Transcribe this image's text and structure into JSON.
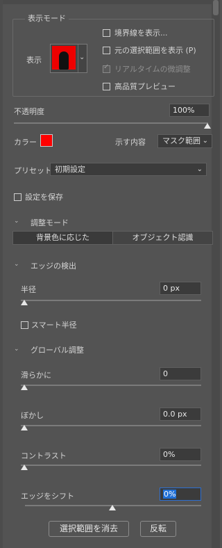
{
  "display_mode": {
    "title": "表示モード",
    "view_label": "表示",
    "options": [
      {
        "label": "境界線を表示...",
        "checked": false,
        "disabled": false
      },
      {
        "label": "元の選択範囲を表示 (P)",
        "checked": false,
        "disabled": false
      },
      {
        "label": "リアルタイムの微調整",
        "checked": true,
        "disabled": true
      },
      {
        "label": "高品質プレビュー",
        "checked": false,
        "disabled": false
      }
    ]
  },
  "opacity": {
    "label": "不透明度",
    "value": "100%"
  },
  "color": {
    "label": "カラー",
    "swatch": "#ff0000"
  },
  "show": {
    "label": "示す内容",
    "value": "マスク範囲"
  },
  "preset": {
    "label": "プリセット",
    "value": "初期設定"
  },
  "save_settings": {
    "label": "設定を保存",
    "checked": false
  },
  "adjust_mode": {
    "title": "調整モード",
    "options": [
      "背景色に応じた",
      "オブジェクト認識"
    ],
    "selected": "背景色に応じた"
  },
  "edge_detection": {
    "title": "エッジの検出",
    "radius_label": "半径",
    "radius_value": "0 px",
    "smart_radius_label": "スマート半径",
    "smart_radius_checked": false
  },
  "global_refine": {
    "title": "グローバル調整",
    "smooth": {
      "label": "滑らかに",
      "value": "0"
    },
    "feather": {
      "label": "ぼかし",
      "value": "0.0 px"
    },
    "contrast": {
      "label": "コントラスト",
      "value": "0%"
    },
    "shift_edge": {
      "label": "エッジをシフト",
      "value": "0%"
    }
  },
  "buttons": {
    "clear": "選択範囲を消去",
    "invert": "反転"
  }
}
